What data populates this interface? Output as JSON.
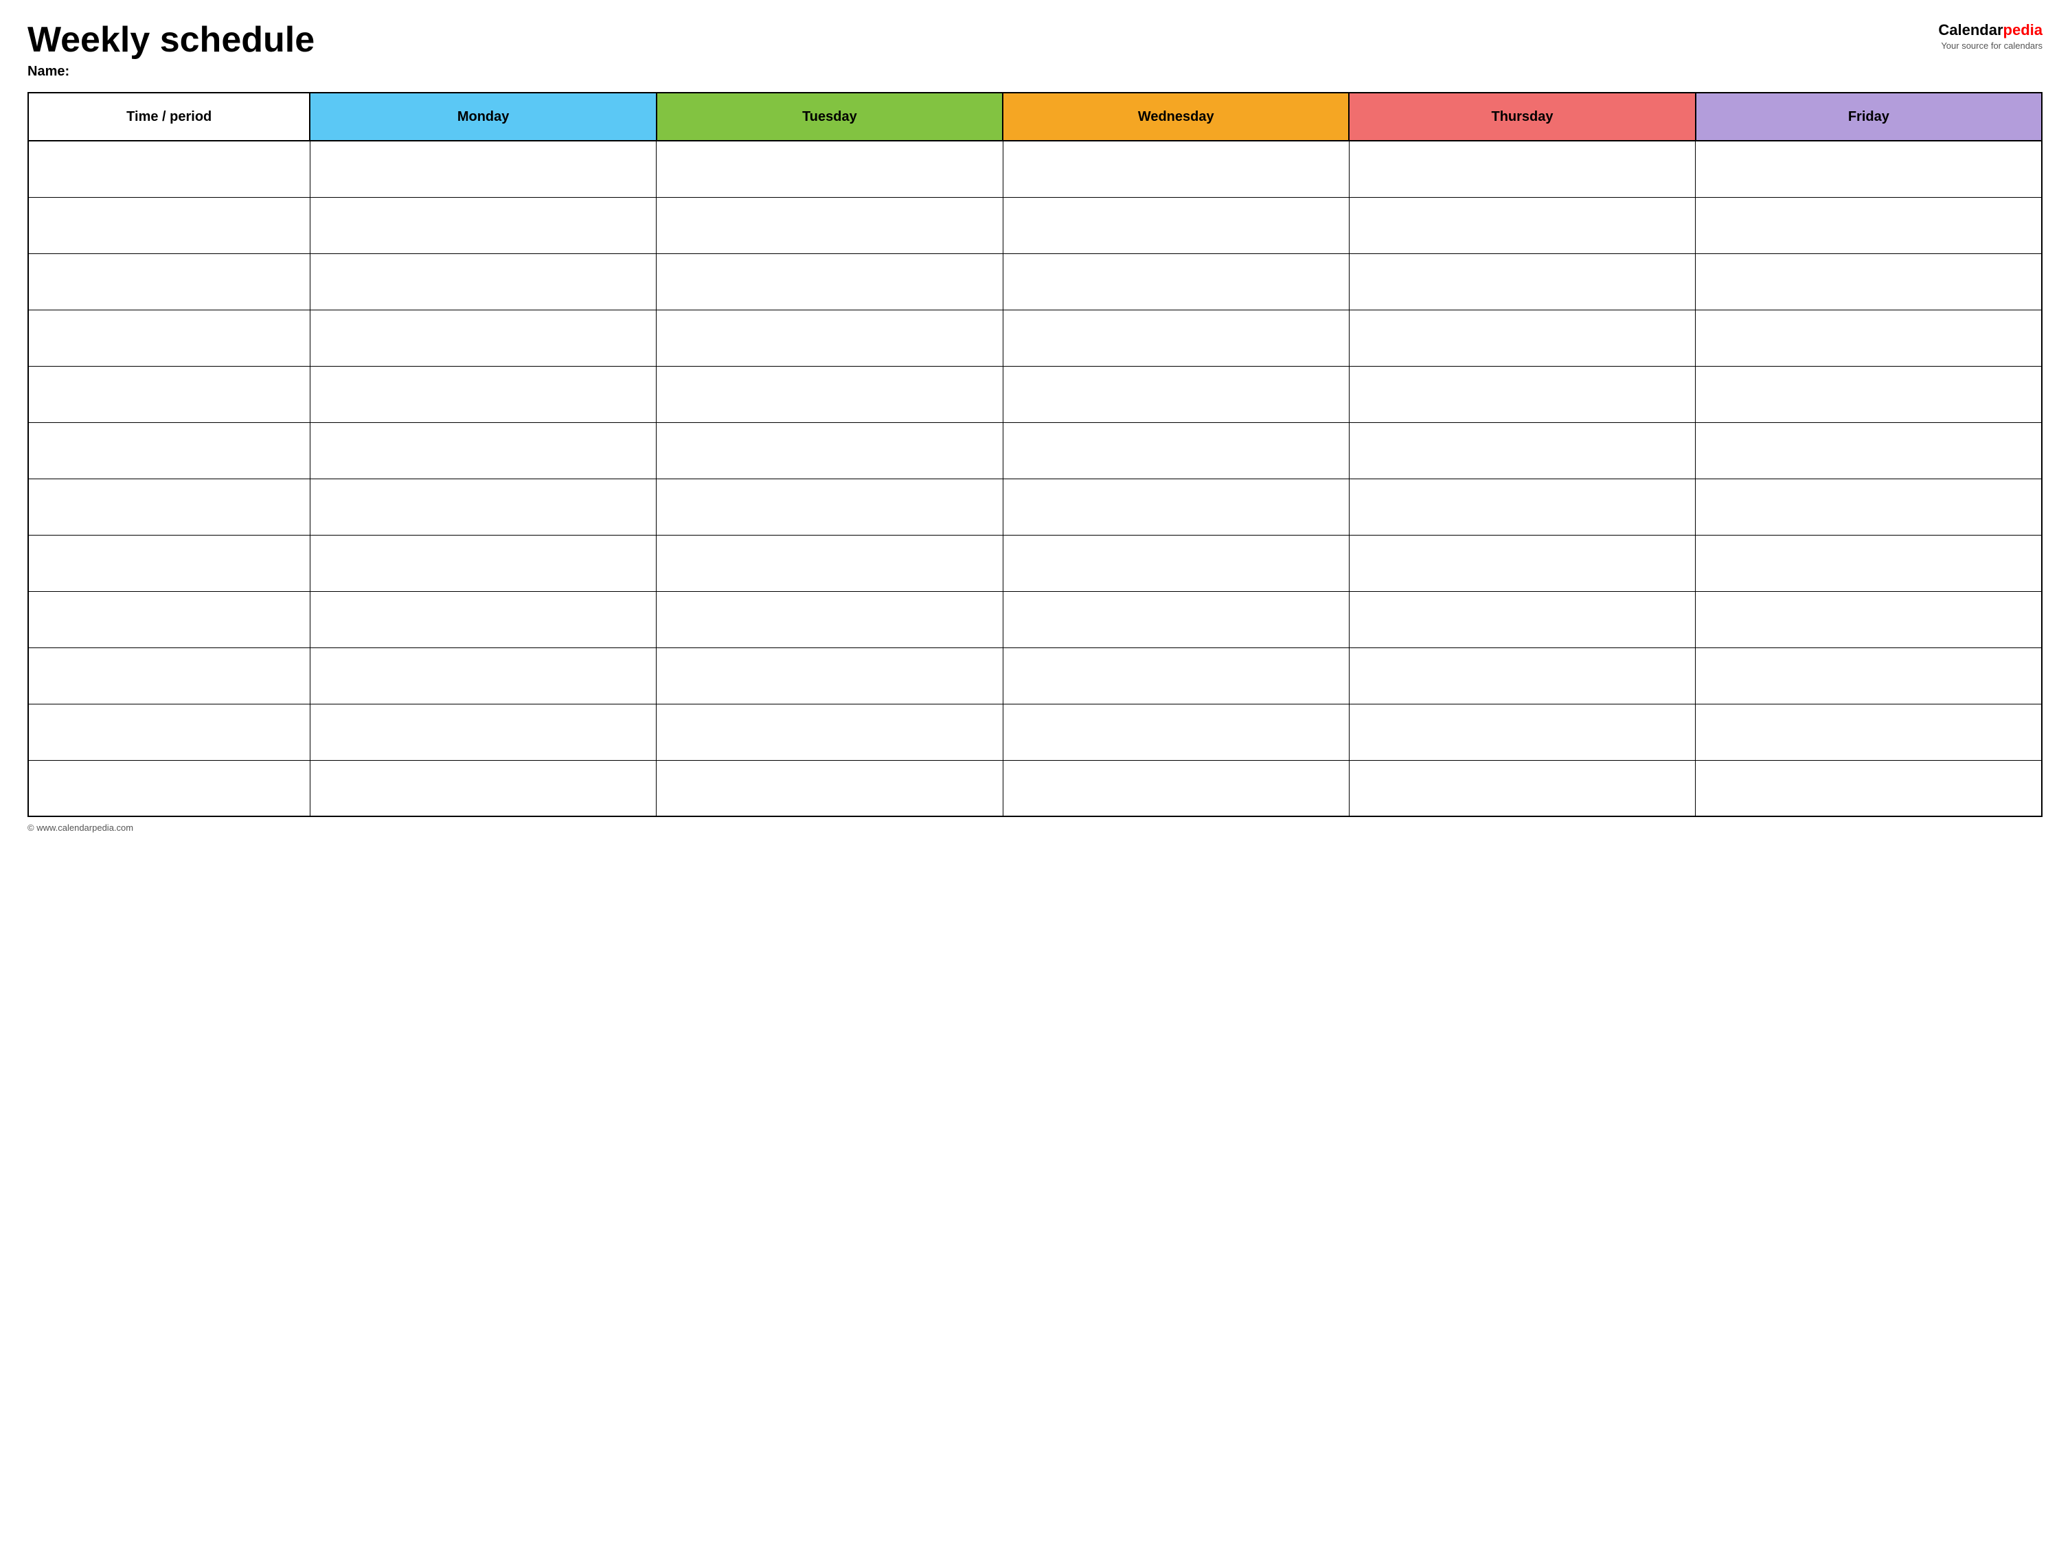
{
  "header": {
    "title": "Weekly schedule",
    "name_label": "Name:",
    "logo_text": "Calendar",
    "logo_pedia": "pedia",
    "logo_subtitle": "Your source for calendars"
  },
  "table": {
    "columns": [
      {
        "id": "time",
        "label": "Time / period",
        "color": "#ffffff"
      },
      {
        "id": "monday",
        "label": "Monday",
        "color": "#5bc8f5"
      },
      {
        "id": "tuesday",
        "label": "Tuesday",
        "color": "#82c341"
      },
      {
        "id": "wednesday",
        "label": "Wednesday",
        "color": "#f5a623"
      },
      {
        "id": "thursday",
        "label": "Thursday",
        "color": "#f06e6e"
      },
      {
        "id": "friday",
        "label": "Friday",
        "color": "#b39ddb"
      }
    ],
    "row_count": 12
  },
  "footer": {
    "url": "© www.calendarpedia.com"
  }
}
